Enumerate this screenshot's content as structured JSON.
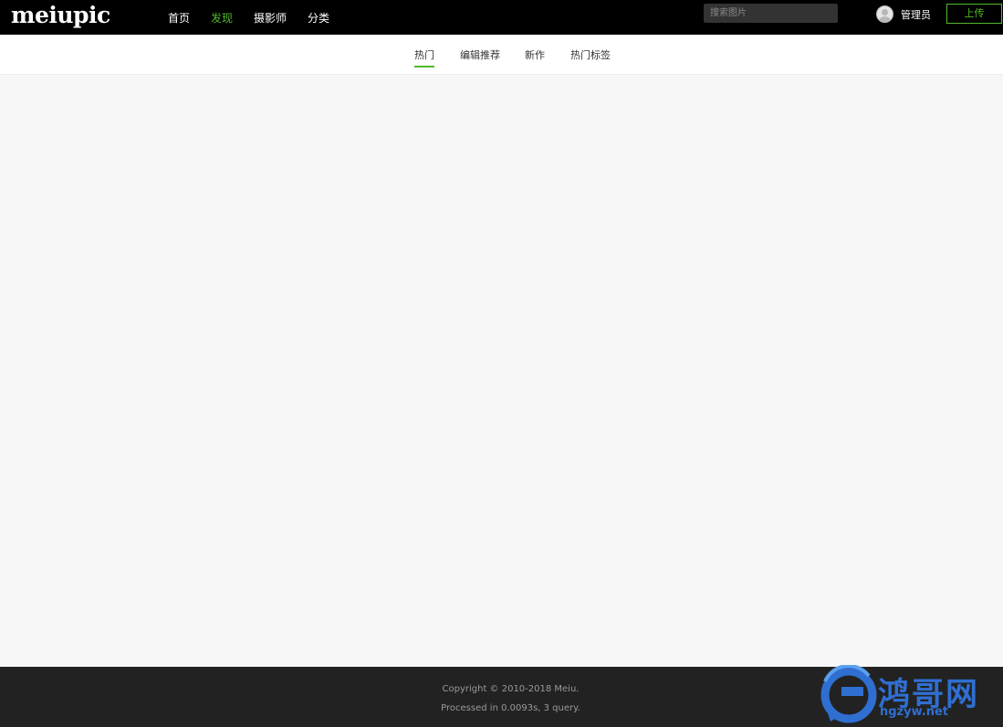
{
  "header": {
    "logo": "meiupic",
    "nav": [
      {
        "label": "首页",
        "active": false
      },
      {
        "label": "发现",
        "active": true
      },
      {
        "label": "摄影师",
        "active": false
      },
      {
        "label": "分类",
        "active": false
      }
    ],
    "search_placeholder": "搜索图片",
    "user_name": "管理员",
    "upload_label": "上传"
  },
  "subnav": {
    "items": [
      {
        "label": "热门",
        "active": true
      },
      {
        "label": "编辑推荐",
        "active": false
      },
      {
        "label": "新作",
        "active": false
      },
      {
        "label": "热门标签",
        "active": false
      }
    ]
  },
  "footer": {
    "copyright": "Copyright © 2010-2018 Meiu.",
    "processed": "Processed in 0.0093s, 3 query."
  },
  "watermark": {
    "text": "鸿哥网",
    "url": "hgzyw.net"
  },
  "colors": {
    "accent": "#52b82a",
    "header_bg": "#000000",
    "footer_bg": "#222222",
    "page_bg": "#f7f7f7",
    "watermark": "#2f6fd1"
  }
}
